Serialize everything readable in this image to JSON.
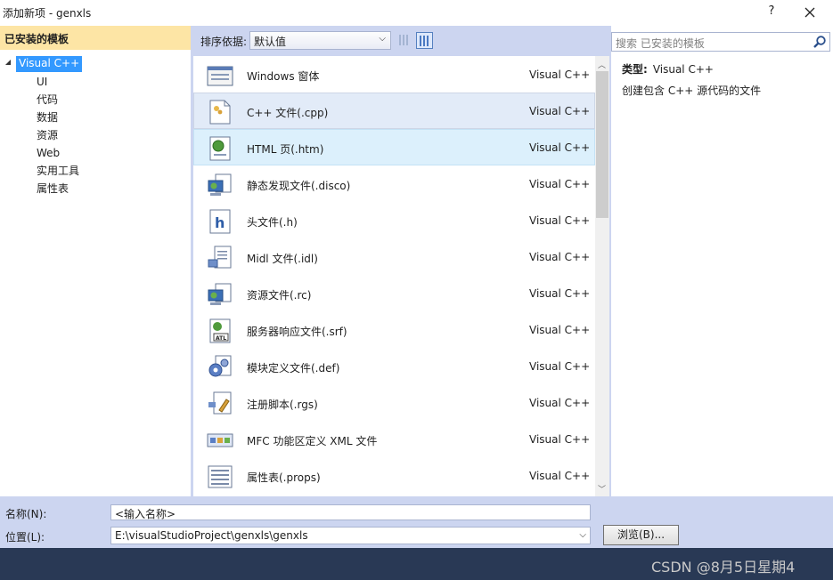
{
  "window": {
    "title": "添加新项 - genxls",
    "help": "?",
    "close": "✕"
  },
  "sidebar": {
    "header": "已安装的模板",
    "root": "Visual C++",
    "items": [
      "UI",
      "代码",
      "数据",
      "资源",
      "Web",
      "实用工具",
      "属性表"
    ]
  },
  "toolbar": {
    "sort_label": "排序依据:",
    "sort_value": "默认值"
  },
  "templates": [
    {
      "name": "Windows 窗体",
      "lang": "Visual C++",
      "icon": "windows-form-icon"
    },
    {
      "name": "C++ 文件(.cpp)",
      "lang": "Visual C++",
      "icon": "cpp-file-icon"
    },
    {
      "name": "HTML 页(.htm)",
      "lang": "Visual C++",
      "icon": "html-page-icon"
    },
    {
      "name": "静态发现文件(.disco)",
      "lang": "Visual C++",
      "icon": "disco-file-icon"
    },
    {
      "name": "头文件(.h)",
      "lang": "Visual C++",
      "icon": "header-file-icon"
    },
    {
      "name": "Midl 文件(.idl)",
      "lang": "Visual C++",
      "icon": "idl-file-icon"
    },
    {
      "name": "资源文件(.rc)",
      "lang": "Visual C++",
      "icon": "resource-file-icon"
    },
    {
      "name": "服务器响应文件(.srf)",
      "lang": "Visual C++",
      "icon": "srf-file-icon"
    },
    {
      "name": "模块定义文件(.def)",
      "lang": "Visual C++",
      "icon": "def-file-icon"
    },
    {
      "name": "注册脚本(.rgs)",
      "lang": "Visual C++",
      "icon": "rgs-file-icon"
    },
    {
      "name": "MFC 功能区定义 XML 文件",
      "lang": "Visual C++",
      "icon": "mfc-ribbon-icon"
    },
    {
      "name": "属性表(.props)",
      "lang": "Visual C++",
      "icon": "props-file-icon"
    }
  ],
  "search": {
    "placeholder": "搜索 已安装的模板"
  },
  "details": {
    "type_label": "类型:",
    "type_value": "Visual C++",
    "description": "创建包含 C++ 源代码的文件"
  },
  "form": {
    "name_label": "名称(N):",
    "name_value": "<输入名称>",
    "location_label": "位置(L):",
    "location_value": "E:\\visualStudioProject\\genxls\\genxls",
    "browse_label": "浏览(B)..."
  },
  "watermark": "CSDN @8月5日星期4",
  "colors": {
    "accent": "#3399ff",
    "header": "#fde5a5",
    "background": "#ccd5f0",
    "footer": "#293955"
  }
}
